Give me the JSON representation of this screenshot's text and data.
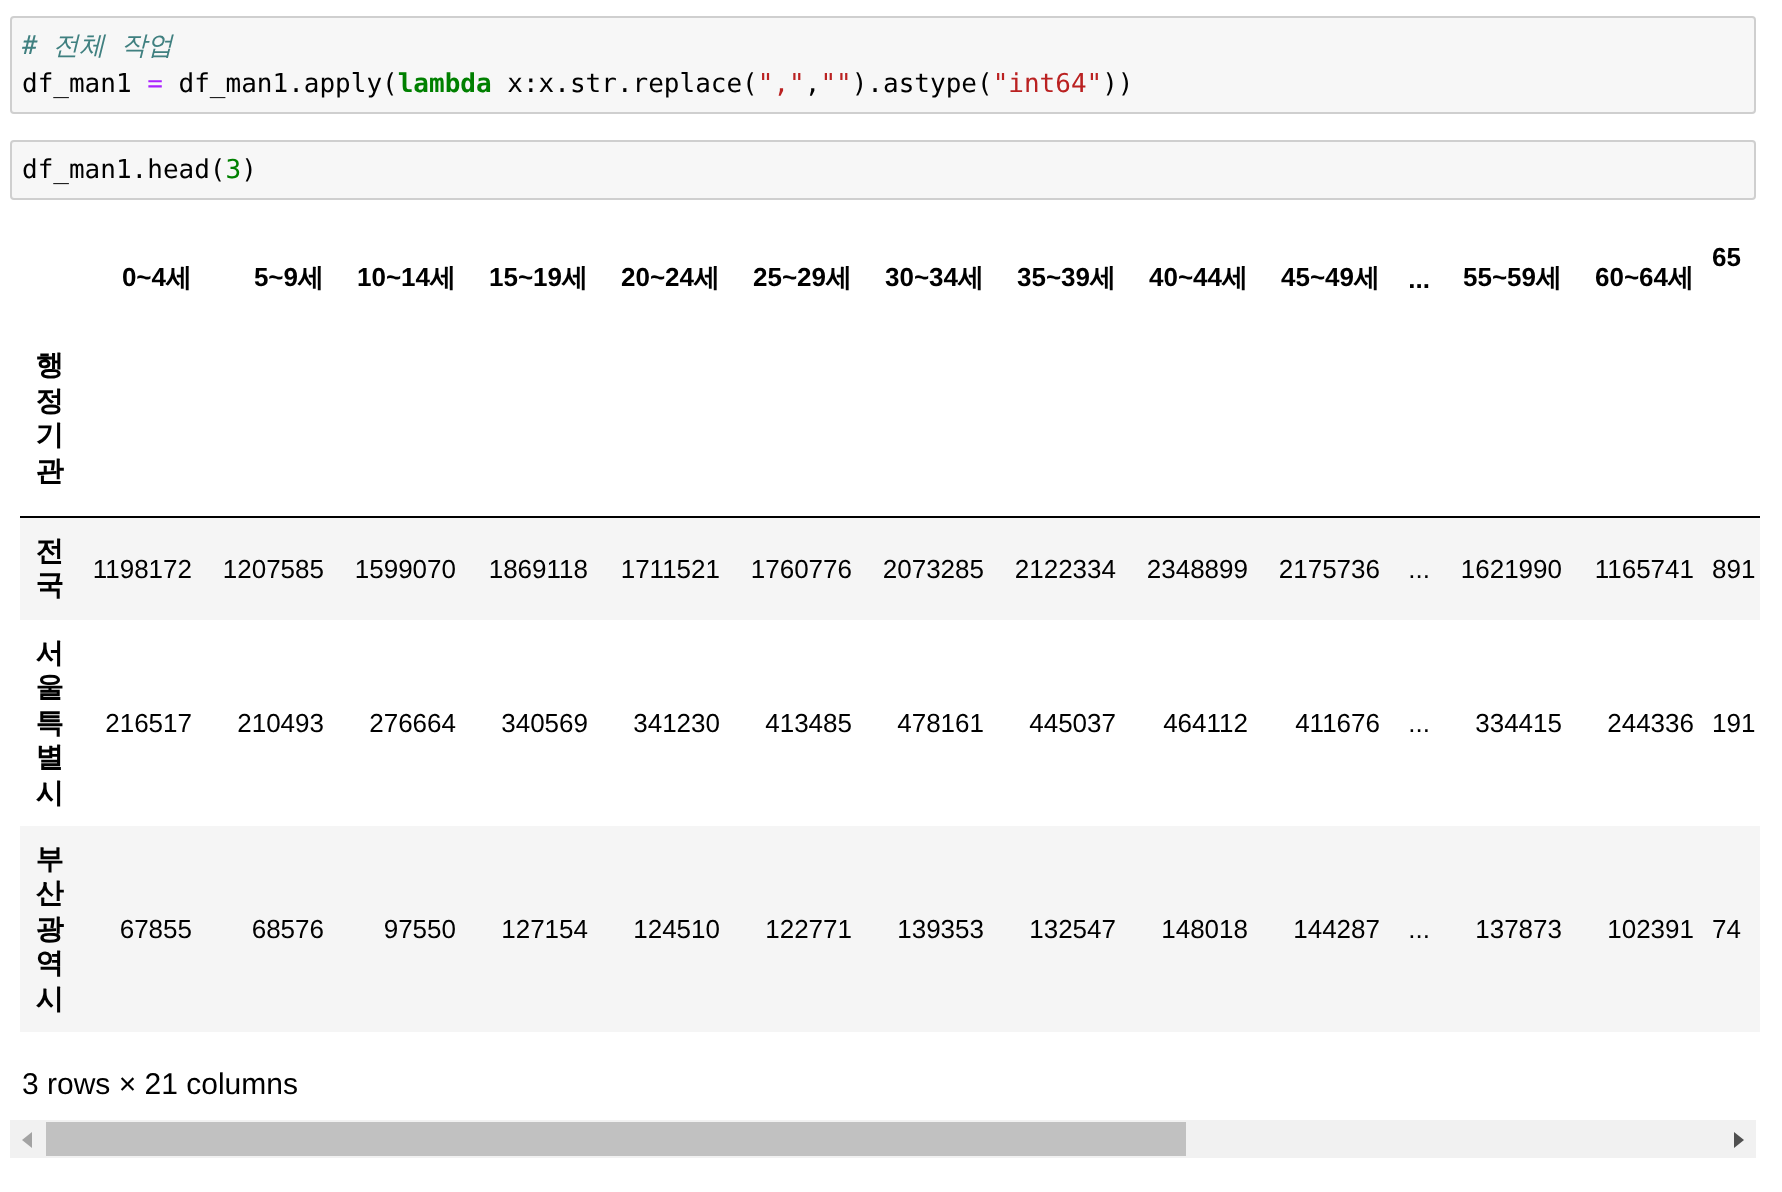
{
  "cells": [
    {
      "lines": [
        [
          {
            "kind": "comment",
            "text": "# 전체 작업"
          }
        ],
        [
          {
            "kind": "plain",
            "text": "df_man1 "
          },
          {
            "kind": "operator",
            "text": "="
          },
          {
            "kind": "plain",
            "text": " df_man1.apply("
          },
          {
            "kind": "keyword",
            "text": "lambda"
          },
          {
            "kind": "plain",
            "text": " x:x.str.replace("
          },
          {
            "kind": "string",
            "text": "\",\""
          },
          {
            "kind": "plain",
            "text": ","
          },
          {
            "kind": "string",
            "text": "\"\""
          },
          {
            "kind": "plain",
            "text": ").astype("
          },
          {
            "kind": "string",
            "text": "\"int64\""
          },
          {
            "kind": "plain",
            "text": "))"
          }
        ]
      ]
    },
    {
      "lines": [
        [
          {
            "kind": "plain",
            "text": "df_man1.head("
          },
          {
            "kind": "number",
            "text": "3"
          },
          {
            "kind": "plain",
            "text": ")"
          }
        ]
      ]
    }
  ],
  "table": {
    "columns": [
      "0~4세",
      "5~9세",
      "10~14세",
      "15~19세",
      "20~24세",
      "25~29세",
      "30~34세",
      "35~39세",
      "40~44세",
      "45~49세",
      "...",
      "55~59세",
      "60~64세",
      "65"
    ],
    "index_name": "행정기관",
    "rows": [
      {
        "index": "전국",
        "values": [
          "1198172",
          "1207585",
          "1599070",
          "1869118",
          "1711521",
          "1760776",
          "2073285",
          "2122334",
          "2348899",
          "2175736",
          "...",
          "1621990",
          "1165741",
          "891"
        ]
      },
      {
        "index": "서울특별시",
        "values": [
          "216517",
          "210493",
          "276664",
          "340569",
          "341230",
          "413485",
          "478161",
          "445037",
          "464112",
          "411676",
          "...",
          "334415",
          "244336",
          "191"
        ]
      },
      {
        "index": "부산광역시",
        "values": [
          "67855",
          "68576",
          "97550",
          "127154",
          "124510",
          "122771",
          "139353",
          "132547",
          "148018",
          "144287",
          "...",
          "137873",
          "102391",
          "74"
        ]
      }
    ]
  },
  "shape_note": "3 rows × 21 columns"
}
